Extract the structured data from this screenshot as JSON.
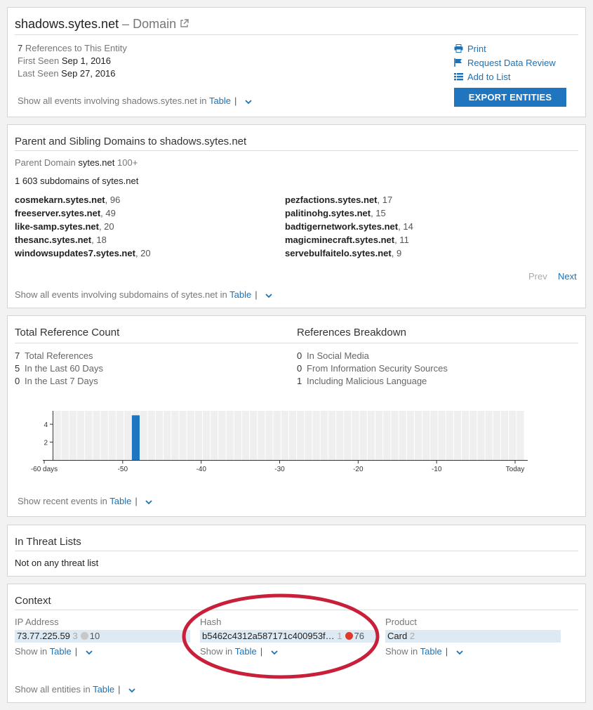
{
  "header": {
    "entity": "shadows.sytes.net",
    "type_label": "– Domain",
    "ref_count": "7",
    "ref_label": "References to This Entity",
    "first_seen_label": "First Seen",
    "first_seen": "Sep 1, 2016",
    "last_seen_label": "Last Seen",
    "last_seen": "Sep 27, 2016",
    "show_prefix": "Show all events involving shadows.sytes.net in",
    "table_link": "Table",
    "actions": {
      "print": "Print",
      "review": "Request Data Review",
      "add_list": "Add to List",
      "export": "EXPORT ENTITIES"
    }
  },
  "parent": {
    "title": "Parent and Sibling Domains to shadows.sytes.net",
    "parent_label": "Parent Domain",
    "parent_domain": "sytes.net",
    "parent_count": "100+",
    "subdomains_line": "1 603 subdomains of sytes.net",
    "left": [
      {
        "name": "cosmekarn.sytes.net",
        "count": ", 96"
      },
      {
        "name": "freeserver.sytes.net",
        "count": ", 49"
      },
      {
        "name": "like-samp.sytes.net",
        "count": ", 20"
      },
      {
        "name": "thesanc.sytes.net",
        "count": ", 18"
      },
      {
        "name": "windowsupdates7.sytes.net",
        "count": ", 20"
      }
    ],
    "right": [
      {
        "name": "pezfactions.sytes.net",
        "count": ", 17"
      },
      {
        "name": "palitinohg.sytes.net",
        "count": ", 15"
      },
      {
        "name": "badtigernetwork.sytes.net",
        "count": ", 14"
      },
      {
        "name": "magicminecraft.sytes.net",
        "count": ", 11"
      },
      {
        "name": "servebulfaitelo.sytes.net",
        "count": ", 9"
      }
    ],
    "prev": "Prev",
    "next": "Next",
    "show_prefix": "Show all events involving subdomains of sytes.net in",
    "table_link": "Table"
  },
  "refs": {
    "title_left": "Total Reference Count",
    "title_right": "References Breakdown",
    "totals": [
      {
        "n": "7",
        "label": "Total References"
      },
      {
        "n": "5",
        "label": "In the Last 60 Days"
      },
      {
        "n": "0",
        "label": "In the Last 7 Days"
      }
    ],
    "breakdown": [
      {
        "n": "0",
        "label": "In Social Media"
      },
      {
        "n": "0",
        "label": "From Information Security Sources"
      },
      {
        "n": "1",
        "label": "Including Malicious Language"
      }
    ],
    "show_prefix": "Show recent events in",
    "table_link": "Table"
  },
  "chart_data": {
    "type": "bar",
    "x_ticks": [
      "-60 days",
      "-50",
      "-40",
      "-30",
      "-20",
      "-10",
      "Today"
    ],
    "y_ticks": [
      "2",
      "4"
    ],
    "bar_day": -50,
    "bar_value": 5,
    "xlim": [
      -60,
      0
    ],
    "ylim": [
      0,
      5.5
    ],
    "color": "#1f76bf"
  },
  "threat": {
    "title": "In Threat Lists",
    "text": "Not on any threat list"
  },
  "context": {
    "title": "Context",
    "cols": [
      {
        "label": "IP Address",
        "value": "73.77.225.59",
        "count": "3",
        "score": "10",
        "dot": "#c8c8c8"
      },
      {
        "label": "Hash",
        "value": "b5462c4312a587171c400953f…",
        "count": "1",
        "score": "76",
        "dot": "#e0392a"
      },
      {
        "label": "Product",
        "value": "Card",
        "count": "2"
      }
    ],
    "show_in": "Show in",
    "table_link": "Table",
    "show_all_prefix": "Show all entities in",
    "annotation_color": "#c8203a"
  }
}
